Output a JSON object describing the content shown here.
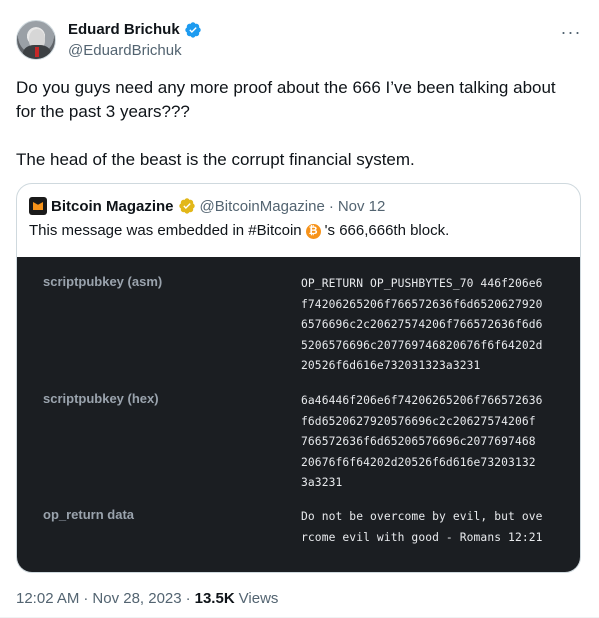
{
  "author": {
    "display_name": "Eduard Brichuk",
    "handle": "@EduardBrichuk",
    "verified_badge_color": "#1d9bf0",
    "avatar_icon": "avatar-photo"
  },
  "more_menu": {
    "label": "···",
    "icon": "more-horizontal-icon"
  },
  "tweet": {
    "text": "Do you guys need any more proof about the 666 I’ve been talking about\nfor the past 3 years???\n\nThe head of the beast is the corrupt financial system."
  },
  "quote": {
    "display_name": "Bitcoin Magazine",
    "handle": "@BitcoinMagazine",
    "separator": "·",
    "date": "Nov 12",
    "badge_color": "#e2b719",
    "text_before": "This message was embedded in #Bitcoin",
    "text_after": "'s 666,666th block.",
    "emoji": "bitcoin-emoji-icon",
    "rows": [
      {
        "label": "scriptpubkey (asm)",
        "value": "OP_RETURN OP_PUSHBYTES_70 446f206e6\nf74206265206f766572636f6d6520627920\n6576696c2c20627574206f766572636f6d6\n5206576696c207769746820676f6f64202d\n20526f6d616e732031323a3231"
      },
      {
        "label": "scriptpubkey (hex)",
        "value": "6a46446f206e6f74206265206f766572636\nf6d6520627920576696c2c20627574206f\n766572636f6d65206576696c2077697468\n20676f6f64202d20526f6d616e73203132\n3a3231"
      },
      {
        "label": "op_return data",
        "value": "Do not be overcome by evil, but ove\nrcome evil with good - Romans 12:21"
      }
    ]
  },
  "footer": {
    "time": "12:02 AM",
    "separator1": "·",
    "date": "Nov 28, 2023",
    "separator2": "·",
    "views_count": "13.5K",
    "views_label": "Views"
  },
  "colors": {
    "text_primary": "#0f1419",
    "text_secondary": "#536471",
    "media_background": "#1b1e22",
    "bitcoin_orange": "#f7931a"
  }
}
